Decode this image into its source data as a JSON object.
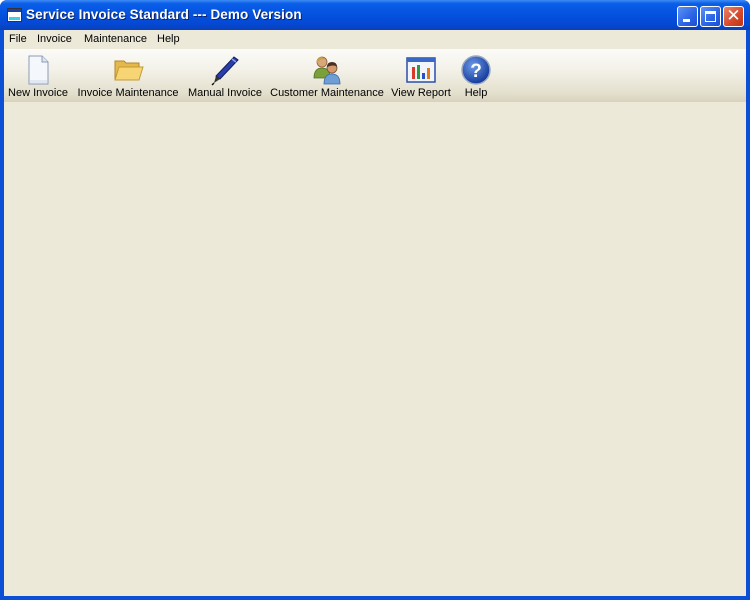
{
  "window": {
    "title": "Service Invoice Standard --- Demo Version",
    "controls": {
      "minimize": "minimize",
      "maximize": "maximize",
      "close": "close"
    }
  },
  "menubar": {
    "items": [
      {
        "label": "File"
      },
      {
        "label": "Invoice"
      },
      {
        "label": "Maintenance"
      },
      {
        "label": "Help"
      }
    ]
  },
  "toolbar": {
    "items": [
      {
        "label": "New Invoice",
        "icon": "new-document-icon"
      },
      {
        "label": "Invoice Maintenance",
        "icon": "folder-icon"
      },
      {
        "label": "Manual Invoice",
        "icon": "pen-icon"
      },
      {
        "label": "Customer Maintenance",
        "icon": "users-icon"
      },
      {
        "label": "View Report",
        "icon": "report-chart-icon"
      },
      {
        "label": "Help",
        "icon": "help-icon"
      }
    ]
  },
  "colors": {
    "titlebar": "#0553e0",
    "client_background": "#ece9d8",
    "close_button": "#d4472a"
  }
}
